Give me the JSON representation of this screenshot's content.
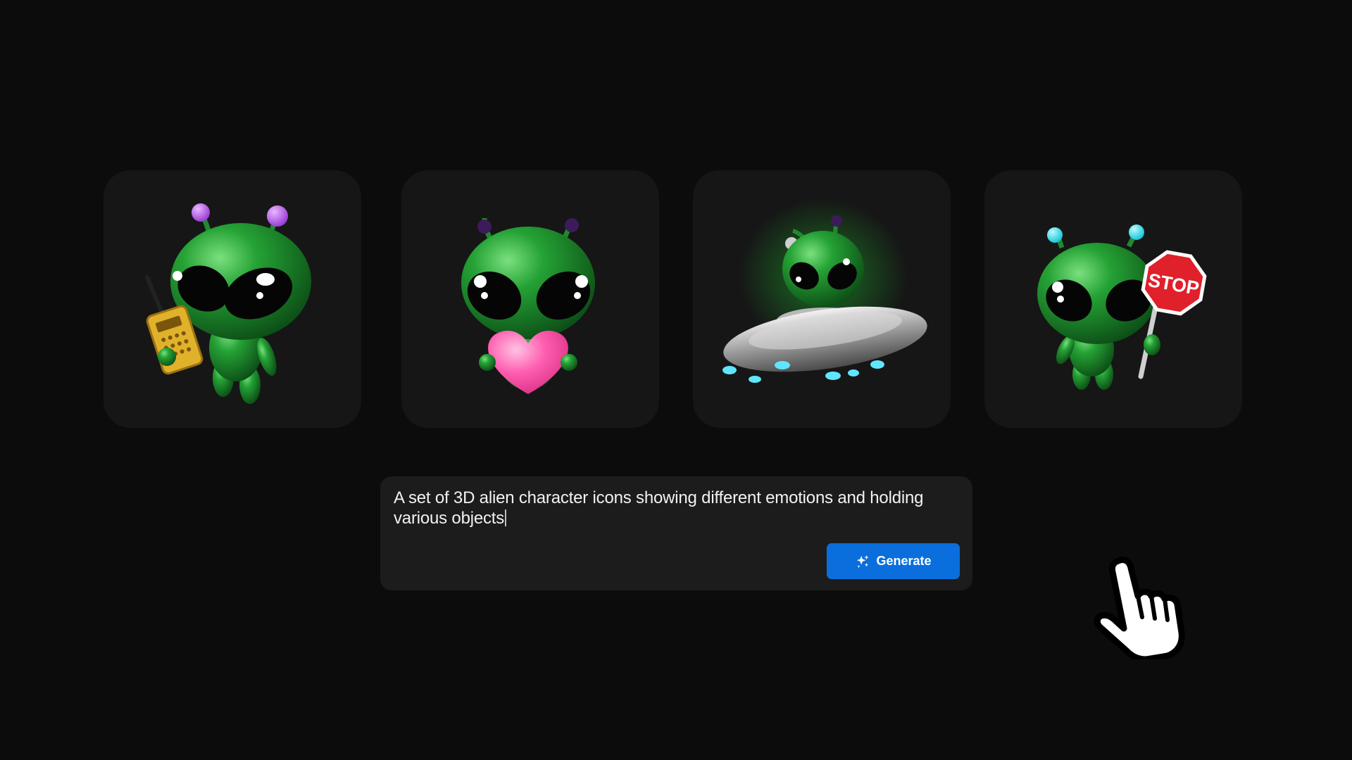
{
  "gallery": {
    "items": [
      {
        "icon": "alien-with-walkie-talkie"
      },
      {
        "icon": "alien-holding-heart"
      },
      {
        "icon": "alien-in-ufo"
      },
      {
        "icon": "alien-with-stop-sign",
        "sign_text": "STOP"
      }
    ]
  },
  "prompt": {
    "text": "A set of 3D alien character icons showing different emotions and holding various objects"
  },
  "generate": {
    "label": "Generate",
    "icon": "sparkles-icon",
    "color": "#0a6fdc"
  },
  "cursor": {
    "icon": "pointing-hand-cursor-icon"
  },
  "colors": {
    "background": "#0c0c0c",
    "card": "#161616",
    "prompt_box": "#1c1c1c",
    "alien_green": "#1f8a2e"
  }
}
